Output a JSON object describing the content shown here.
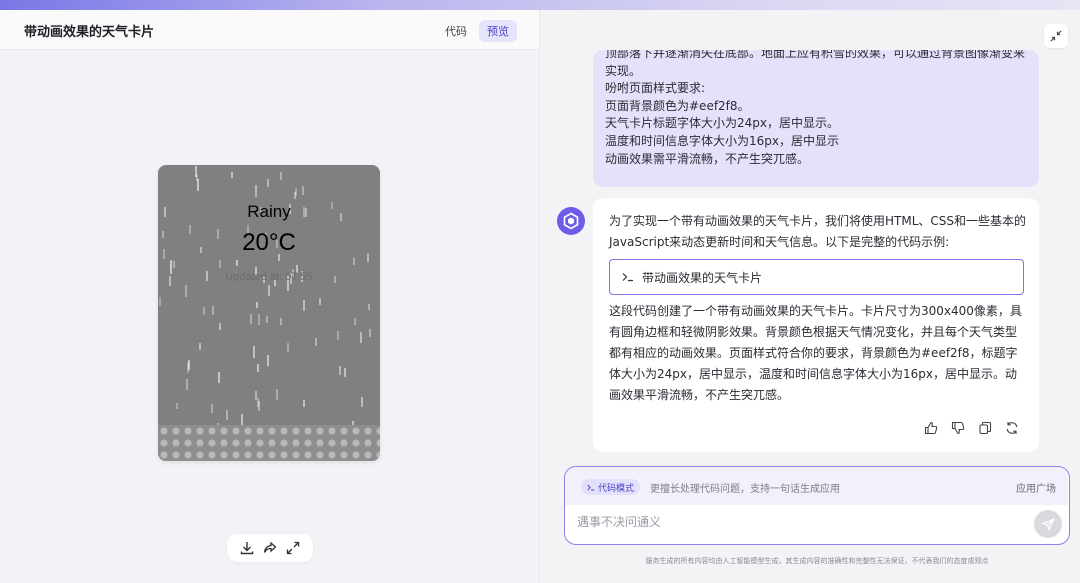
{
  "left": {
    "title": "带动画效果的天气卡片",
    "tabs": [
      {
        "label": "代码",
        "active": false
      },
      {
        "label": "预览",
        "active": true
      }
    ],
    "card": {
      "weather": "Rainy",
      "temperature": "20°C",
      "updated": "Updated at: 07:55"
    },
    "toolbar": [
      "download-icon",
      "share-icon",
      "fullscreen-icon"
    ]
  },
  "right": {
    "user_message": {
      "cut_line": "顶部落下并逐渐消失在底部。地面上应有积雪的效果，可以通过背景图像渐变来",
      "lines": [
        "实现。",
        "吩咐页面样式要求:",
        "页面背景颜色为#eef2f8。",
        "天气卡片标题字体大小为24px，居中显示。",
        "温度和时间信息字体大小为16px，居中显示",
        "动画效果需平滑流畅，不产生突兀感。"
      ]
    },
    "ai_message": {
      "intro": "为了实现一个带有动画效果的天气卡片，我们将使用HTML、CSS和一些基本的JavaScript来动态更新时间和天气信息。以下是完整的代码示例:",
      "code_chip": "带动画效果的天气卡片",
      "description": "这段代码创建了一个带有动画效果的天气卡片。卡片尺寸为300x400像素，具有圆角边框和轻微阴影效果。背景颜色根据天气情况变化，并且每个天气类型都有相应的动画效果。页面样式符合你的要求，背景颜色为#eef2f8，标题字体大小为24px，居中显示，温度和时间信息字体大小为16px，居中显示。动画效果平滑流畅，不产生突兀感。",
      "actions": [
        "thumbs-up-icon",
        "thumbs-down-icon",
        "copy-icon",
        "regenerate-icon"
      ]
    },
    "input": {
      "mode_label": "代码模式",
      "mode_desc": "更擅长处理代码问题，支持一句话生成应用",
      "app_plaza": "应用广场",
      "placeholder": "遇事不决问通义"
    },
    "disclaimer": "服务生成的所有内容均由人工智能模型生成，其生成内容的准确性和完整性无法保证，不代表我们的态度或观点"
  },
  "colors": {
    "accent": "#6d5ce8",
    "user_bubble": "#e4e2fb",
    "card_bg": "#808080"
  }
}
